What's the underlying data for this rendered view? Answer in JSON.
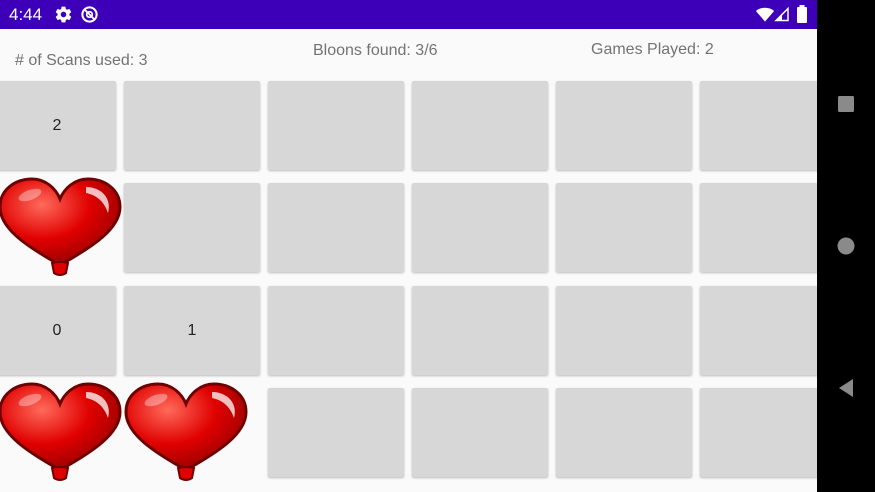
{
  "status_bar": {
    "time": "4:44",
    "icons": [
      "gear-icon",
      "no-sim-icon",
      "wifi-icon",
      "signal-icon",
      "battery-icon"
    ],
    "color": "#3d00b8"
  },
  "stats": {
    "scans_used": "# of Scans used: 3",
    "bloons_found": "Bloons found: 3/6",
    "games_played": "Games Played: 2"
  },
  "grid": {
    "columns": 6,
    "rows": [
      [
        {
          "type": "number",
          "value": "2"
        },
        {
          "type": "empty"
        },
        {
          "type": "empty"
        },
        {
          "type": "empty"
        },
        {
          "type": "empty"
        },
        {
          "type": "empty"
        }
      ],
      [
        {
          "type": "balloon"
        },
        {
          "type": "empty"
        },
        {
          "type": "empty"
        },
        {
          "type": "empty"
        },
        {
          "type": "empty"
        },
        {
          "type": "empty"
        }
      ],
      [
        {
          "type": "number",
          "value": "0"
        },
        {
          "type": "number",
          "value": "1"
        },
        {
          "type": "empty"
        },
        {
          "type": "empty"
        },
        {
          "type": "empty"
        },
        {
          "type": "empty"
        }
      ],
      [
        {
          "type": "balloon"
        },
        {
          "type": "balloon"
        },
        {
          "type": "empty"
        },
        {
          "type": "empty"
        },
        {
          "type": "empty"
        },
        {
          "type": "empty"
        }
      ]
    ],
    "cell_color": "#d7d7d7",
    "balloon_icon": "heart-balloon-icon",
    "balloon_color": "#e00000"
  },
  "nav_bar": {
    "buttons": [
      "recents-square-icon",
      "home-circle-icon",
      "back-triangle-icon"
    ]
  }
}
